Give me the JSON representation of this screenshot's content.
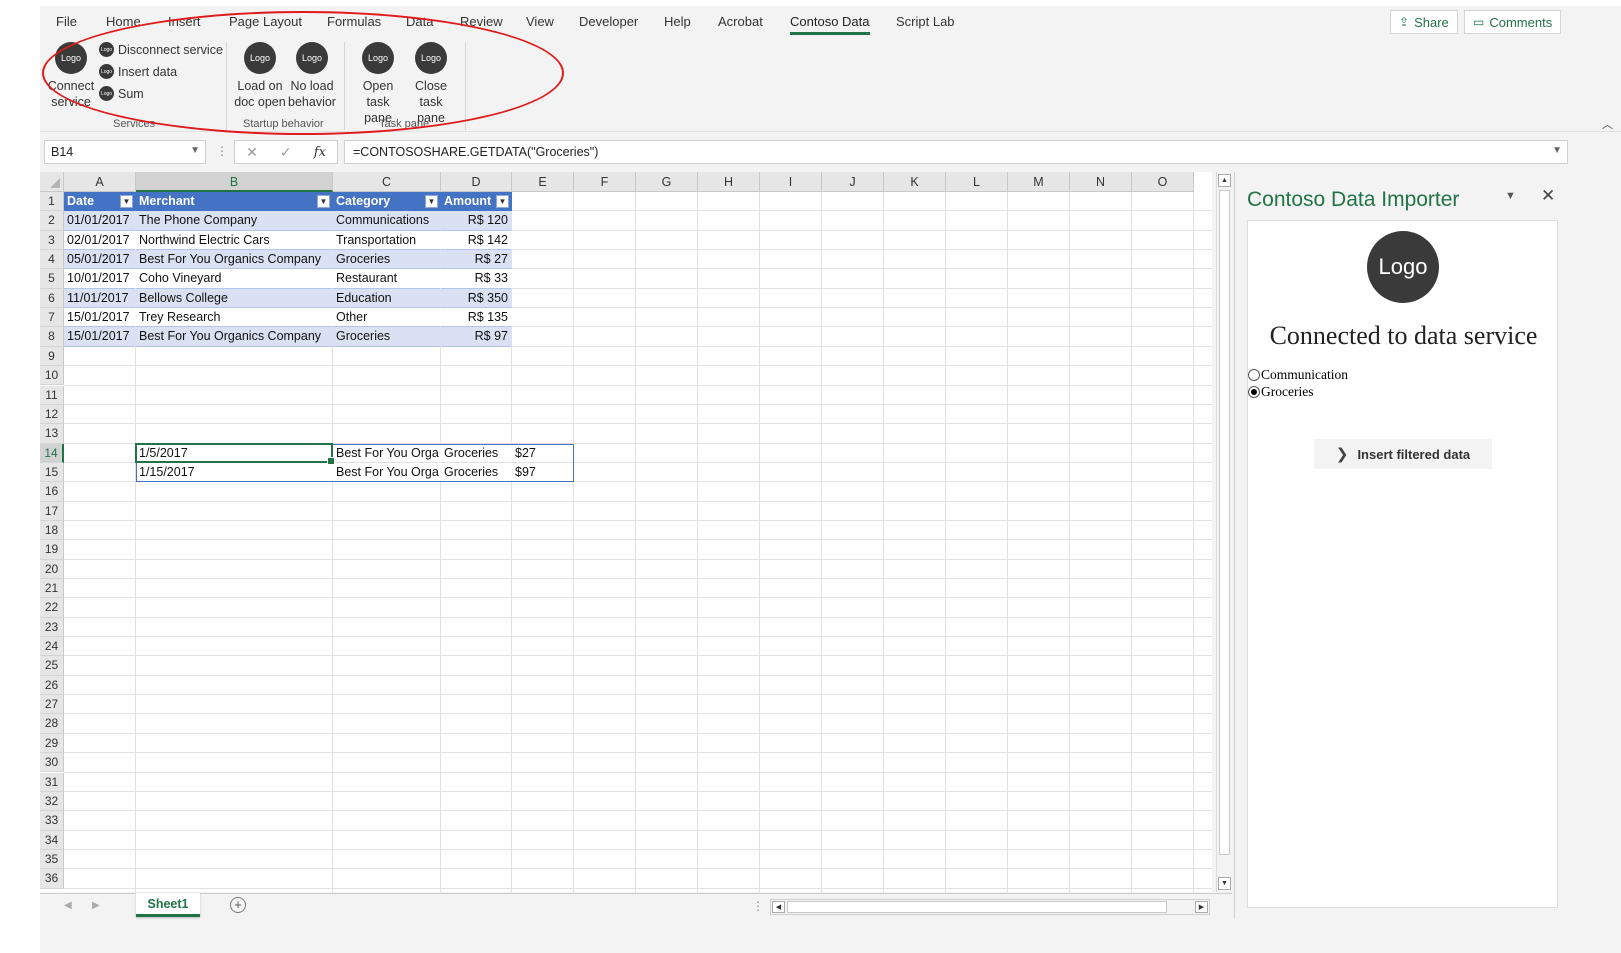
{
  "ribbon": {
    "tabs": [
      "File",
      "Home",
      "Insert",
      "Page Layout",
      "Formulas",
      "Data",
      "Review",
      "View",
      "Developer",
      "Help",
      "Acrobat",
      "Contoso Data",
      "Script Lab"
    ],
    "active_tab": "Contoso Data",
    "share_label": "Share",
    "comments_label": "Comments",
    "logo_text": "Logo",
    "services": {
      "group_label": "Services",
      "connect_label": "Connect\nservice",
      "disconnect_label": "Disconnect service",
      "insert_data_label": "Insert data",
      "sum_label": "Sum"
    },
    "startup": {
      "group_label": "Startup behavior",
      "load_label": "Load on\ndoc open",
      "noload_label": "No load\nbehavior"
    },
    "taskpane": {
      "group_label": "Task pane",
      "open_label": "Open\ntask pane",
      "close_label": "Close\ntask pane"
    }
  },
  "formula_bar": {
    "name_box": "B14",
    "formula": "=CONTOSOSHARE.GETDATA(\"Groceries\")",
    "fx": "fx"
  },
  "grid": {
    "columns": [
      "A",
      "B",
      "C",
      "D",
      "E",
      "F",
      "G",
      "H",
      "I",
      "J",
      "K",
      "L",
      "M",
      "N",
      "O"
    ],
    "selected_column": "B",
    "selected_row": 14,
    "row_count": 36,
    "table": {
      "headers": [
        "Date",
        "Merchant",
        "Category",
        "Amount"
      ],
      "rows": [
        [
          "01/01/2017",
          "The Phone Company",
          "Communications",
          "R$ 120"
        ],
        [
          "02/01/2017",
          "Northwind Electric Cars",
          "Transportation",
          "R$ 142"
        ],
        [
          "05/01/2017",
          "Best For You Organics Company",
          "Groceries",
          "R$ 27"
        ],
        [
          "10/01/2017",
          "Coho Vineyard",
          "Restaurant",
          "R$ 33"
        ],
        [
          "11/01/2017",
          "Bellows College",
          "Education",
          "R$ 350"
        ],
        [
          "15/01/2017",
          "Trey Research",
          "Other",
          "R$ 135"
        ],
        [
          "15/01/2017",
          "Best For You Organics Company",
          "Groceries",
          "R$ 97"
        ]
      ]
    },
    "spill": {
      "rows": [
        [
          "1/5/2017",
          "Best For You Orga",
          "Groceries",
          "$27"
        ],
        [
          "1/15/2017",
          "Best For You Orga",
          "Groceries",
          "$97"
        ]
      ]
    }
  },
  "sheets": {
    "active": "Sheet1"
  },
  "task_pane": {
    "title": "Contoso Data Importer",
    "logo_text": "Logo",
    "heading": "Connected to data service",
    "options": [
      {
        "label": "Communication",
        "selected": false
      },
      {
        "label": "Groceries",
        "selected": true
      }
    ],
    "insert_button": "Insert filtered data"
  },
  "colors": {
    "accent": "#217346",
    "table_header": "#4472c4",
    "table_band": "#d9e1f2",
    "annotation": "#e0191b"
  }
}
